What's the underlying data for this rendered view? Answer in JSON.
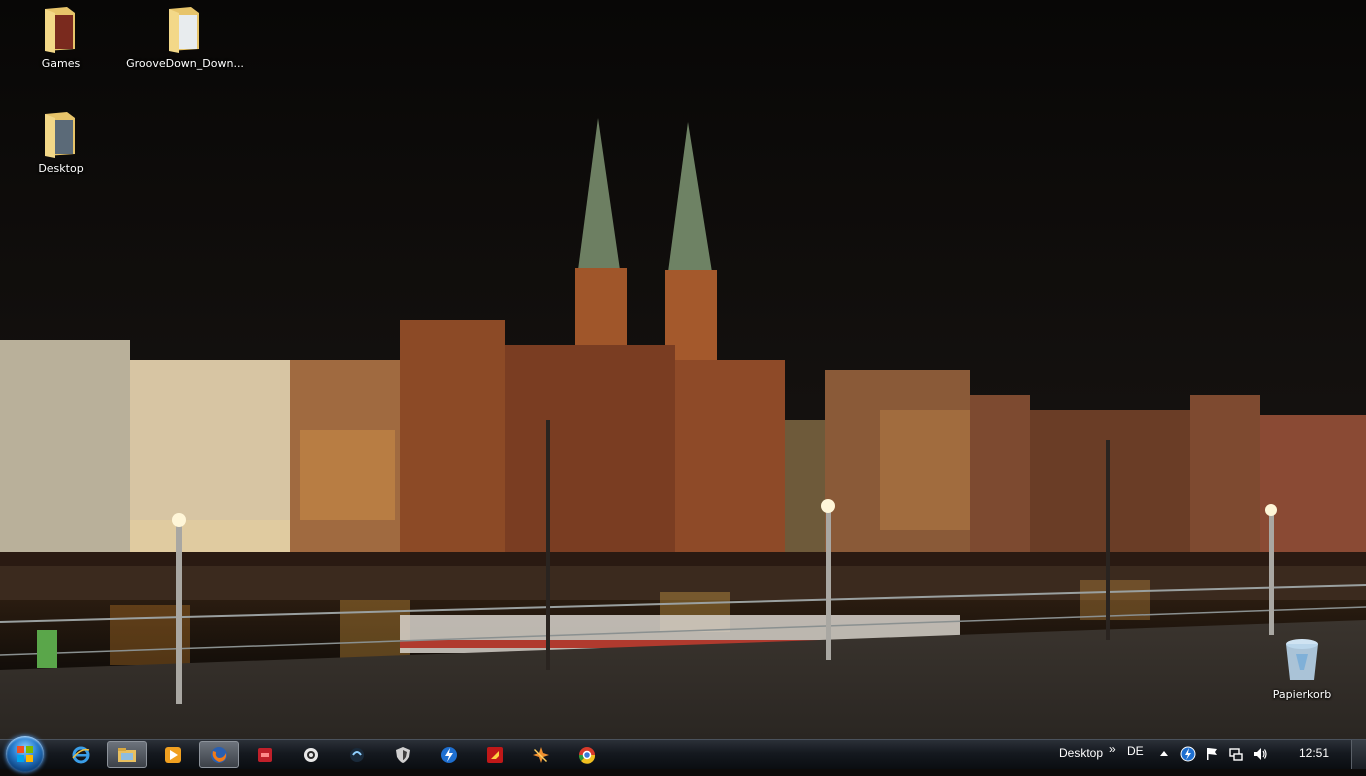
{
  "desktop": {
    "icons": [
      {
        "label": "Games",
        "icon": "folder-icon"
      },
      {
        "label": "GrooveDown_Down...",
        "icon": "folder-icon"
      },
      {
        "label": "Desktop",
        "icon": "folder-icon"
      },
      {
        "label": "Papierkorb",
        "icon": "recycle-bin-icon"
      }
    ]
  },
  "taskbar": {
    "pinned": [
      {
        "name": "internet-explorer-icon"
      },
      {
        "name": "windows-explorer-icon",
        "active": true
      },
      {
        "name": "media-player-icon"
      },
      {
        "name": "firefox-icon",
        "active": true
      },
      {
        "name": "red-app-icon"
      },
      {
        "name": "steam-like-icon"
      },
      {
        "name": "dark-orb-app-icon"
      },
      {
        "name": "shield-app-icon"
      },
      {
        "name": "blue-bolt-app-icon"
      },
      {
        "name": "red-arrow-app-icon"
      },
      {
        "name": "orange-star-app-icon"
      },
      {
        "name": "chrome-like-icon"
      }
    ],
    "toolbar_label": "Desktop",
    "toolbar_chevron": "»",
    "language": "DE",
    "clock": "12:51"
  },
  "colors": {
    "taskbar": "#15191f",
    "sky": "#0d0b0a",
    "city_glow": "#c8782a",
    "river": "#1a1410"
  }
}
